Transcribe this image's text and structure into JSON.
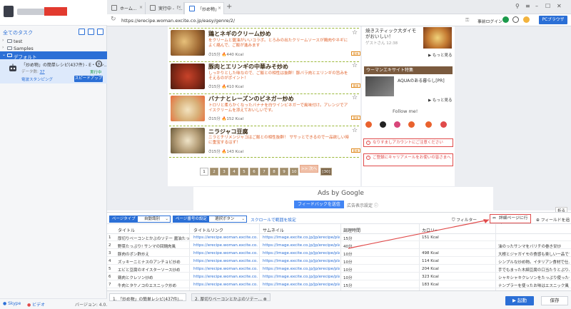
{
  "sidebar": {
    "all_tasks_label": "全てのタスク",
    "tree": [
      {
        "label": "test"
      },
      {
        "label": "Samples"
      },
      {
        "label": "デフォルト"
      }
    ],
    "task": {
      "title": "「炒め物」の簡単レシピ(437件) - E・レシ...",
      "meta_label": "データ数:",
      "meta_value": "37",
      "mode_label": "電波スタンピング",
      "status": "実行中",
      "speed_button": "スピードアップ"
    },
    "footer": {
      "skype": "Skype",
      "video": "ビデオ",
      "version": "バージョン: 4.0.2"
    }
  },
  "browser": {
    "tabs": [
      {
        "label": "ホーム..."
      },
      {
        "label": "実行中 -「..."
      },
      {
        "label": "「炒め物」"
      }
    ],
    "url": "https://erecipe.woman.excite.co.jp/easy/genre/2/",
    "login_label": "事前ログイン",
    "pc_browser_label": "PCブラウザ"
  },
  "recipes": [
    {
      "name": "鶏とネギのクリーム炒め",
      "desc": "をクリームと醤油がいいコラボ。とろみの出たクリームソースが鶏肉やネギによく絡んで、ご飯が進みます",
      "time": "15分",
      "kcal": "440 Kcal",
      "tag": "簡単"
    },
    {
      "name": "豚肉とエリンギの中華みそ炒め",
      "desc": "しっかりとした味なので、ご飯との相性は抜群！豚バラ肉とエリンギの旨みをそえるのがポイント！",
      "time": "15分",
      "kcal": "410 Kcal",
      "tag": "簡単"
    },
    {
      "name": "バナナとレーズンのビネガー炒め",
      "desc": "トロリと柔らかくなったバナナを白ワインビネガーで風味付け。アレンジでアイスクリームを添えておいしいです。",
      "time": "15分",
      "kcal": "152 Kcal",
      "tag": "簡単"
    },
    {
      "name": "ニラジャコ豆腐",
      "desc": "ニラとチリメンジャコはご飯との相性抜群！ ササッとできるので一品欲しい時に重宝するはず！",
      "time": "15分",
      "kcal": "143 Kcal",
      "tag": "簡単"
    }
  ],
  "pager": {
    "pages": [
      "1",
      "2",
      "3",
      "4",
      "5",
      "6",
      "7",
      "8",
      "9",
      "10"
    ],
    "next": ">> 次へ",
    "last": "[30]"
  },
  "right_column": {
    "top_text1": "焼きスティック大ダイモ がおいしい！",
    "top_text2": "ゲストさん 12:38",
    "more1": "もっと見る",
    "banner": "ウーマンエキサイト特集",
    "feature_text": "AQUAのある暮らし[PR]",
    "more2": "もっと見る",
    "follow": "Follow me!",
    "alert1": "なりすましアカウントにご注意ください",
    "alert2": "ご登録にキャリアメールをお使いの皆さまへ"
  },
  "ads": {
    "ads_by": "Ads by Google",
    "feedback_button": "フィードバックを送信",
    "ad_settings": "広告表示設定 ⓘ",
    "collapse": "折る"
  },
  "extraction": {
    "list_type_label": "ページタイプ",
    "list_type_value": "自動識別",
    "page_type_label": "ページ番号の設定",
    "page_type_value": "選択ボタン",
    "scroll_label": "スクロールで範囲を設定",
    "filter_label": "フィルター",
    "detail_button": "詳細ページに行く",
    "add_field": "フィールドを追加"
  },
  "table": {
    "headers": [
      "タイトル",
      "タイトルリンク",
      "サムネイル",
      "調理時間",
      "カロリー",
      ""
    ],
    "rows": [
      [
        "厚切りベーコンとかぶのソテー 醤油たっぷり",
        "https://erecipe.woman.excite.co.jp/detail/...",
        "https://image.excite.co.jp/jp/erecipe/place-h...",
        "15分",
        "151 Kcal",
        ""
      ],
      [
        "野菜たっぷり! サンマの回鍋肉風",
        "https://erecipe.woman.excite.co.jp/detail/...",
        "https://image.excite.co.jp/jp/erecipe/place-h...",
        "40分",
        "",
        "油のったサンマをバリチの巻き甘炒"
      ],
      [
        "豚肉のポン酢炒え",
        "https://erecipe.woman.excite.co.jp/detail/...",
        "https://image.excite.co.jp/jp/erecipe/place-h...",
        "10分",
        "498 Kcal",
        "大根とジャガイモの食感も楽しい一品です。"
      ],
      [
        "ズッキーニとナスのアンチョビ炒め",
        "https://erecipe.woman.excite.co.jp/detail/...",
        "https://image.excite.co.jp/jp/erecipe/place-h...",
        "10分",
        "114 Kcal",
        "シンプルな炒め物。イタリアン食材で仕上げ"
      ],
      [
        "エビと豆腐のオイスターソース炒め",
        "https://erecipe.woman.excite.co.jp/detail/...",
        "https://image.excite.co.jp/jp/erecipe/place-h...",
        "10分",
        "204 Kcal",
        "手でもまった木綿豆腐の口当たりとぷりぷり"
      ],
      [
        "鶏肉とクレソン炒め",
        "https://erecipe.woman.excite.co.jp/detail/...",
        "https://image.excite.co.jp/jp/erecipe/place-h...",
        "10分",
        "323 Kcal",
        "シャキシャキクレソンをたっぷり使った一品"
      ],
      [
        "牛肉とタケノコのエスニック炒め",
        "https://erecipe.woman.excite.co.jp/detail/...",
        "https://image.excite.co.jp/jp/erecipe/place-h...",
        "15分",
        "183 Kcal",
        "ナンプラーを使ったお味はエスニック風"
      ]
    ]
  },
  "bottom": {
    "tabs": [
      "1. 「炒め物」の簡単レシピ(437件)...",
      "2. 厚切りベーコンとかぶのソテー..."
    ],
    "start": "▶ 起動",
    "save": "保存"
  },
  "colors": {
    "accent": "#2b6fd6",
    "alert": "#e04a4a",
    "recipe_title": "#3a2a14",
    "desc": "#e0612b"
  }
}
